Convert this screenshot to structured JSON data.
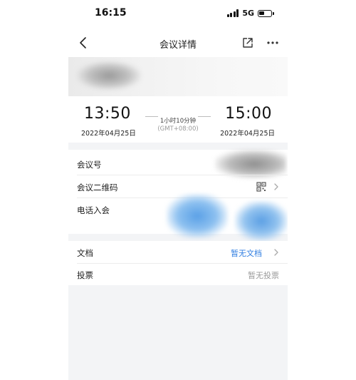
{
  "status_bar": {
    "time": "16:15",
    "network": "5G"
  },
  "nav": {
    "title": "会议详情"
  },
  "schedule": {
    "start_time": "13:50",
    "start_date": "2022年04月25日",
    "end_time": "15:00",
    "end_date": "2022年04月25日",
    "duration": "1小时10分钟",
    "timezone": "(GMT+08:00)"
  },
  "info": {
    "rows": [
      {
        "label": "会议号"
      },
      {
        "label": "会议二维码"
      },
      {
        "label": "电话入会"
      }
    ]
  },
  "docs": {
    "document_label": "文档",
    "document_value": "暂无文档",
    "vote_label": "投票",
    "vote_value": "暂无投票"
  },
  "colors": {
    "accent": "#2f7de1",
    "background": "#f3f4f6"
  }
}
